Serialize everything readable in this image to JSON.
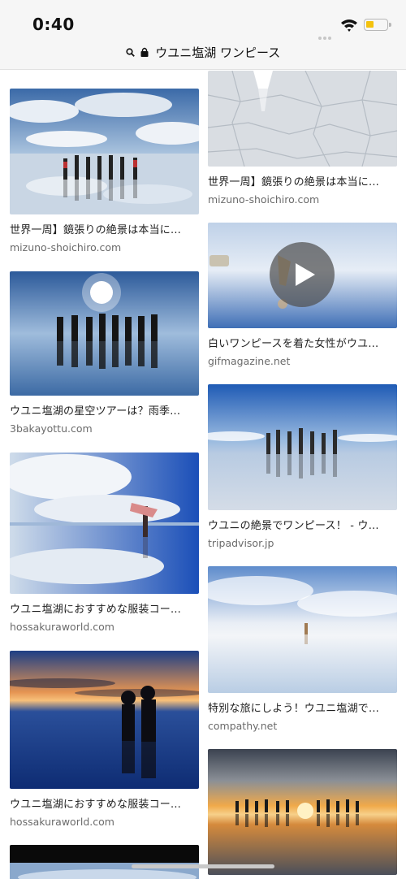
{
  "status_bar": {
    "time": "0:40",
    "battery_color": "#f4c20d"
  },
  "url_bar": {
    "query": "ウユニ塩湖 ワンピース",
    "search_icon": "search-icon",
    "lock_icon": "lock-icon"
  },
  "results_left": [
    {
      "title": "世界一周】鏡張りの絶景は本当に...",
      "source": "mizuno-shoichiro.com"
    },
    {
      "title": "ウユニ塩湖の星空ツアーは？雨季...",
      "source": "3bakayottu.com"
    },
    {
      "title": "ウユニ塩湖におすすめな服装コー...",
      "source": "hossakuraworld.com"
    },
    {
      "title": "ウユニ塩湖におすすめな服装コー...",
      "source": "hossakuraworld.com"
    }
  ],
  "results_right": [
    {
      "title": "世界一周】鏡張りの絶景は本当に...",
      "source": "mizuno-shoichiro.com"
    },
    {
      "title": "白いワンピースを着た女性がウユ...",
      "source": "gifmagazine.net",
      "play_icon": "play-icon"
    },
    {
      "title": "ウユニの絶景でワンピース！ - ウ...",
      "source": "tripadvisor.jp"
    },
    {
      "title": "特別な旅にしよう！ウユニ塩湖で...",
      "source": "compathy.net"
    }
  ]
}
